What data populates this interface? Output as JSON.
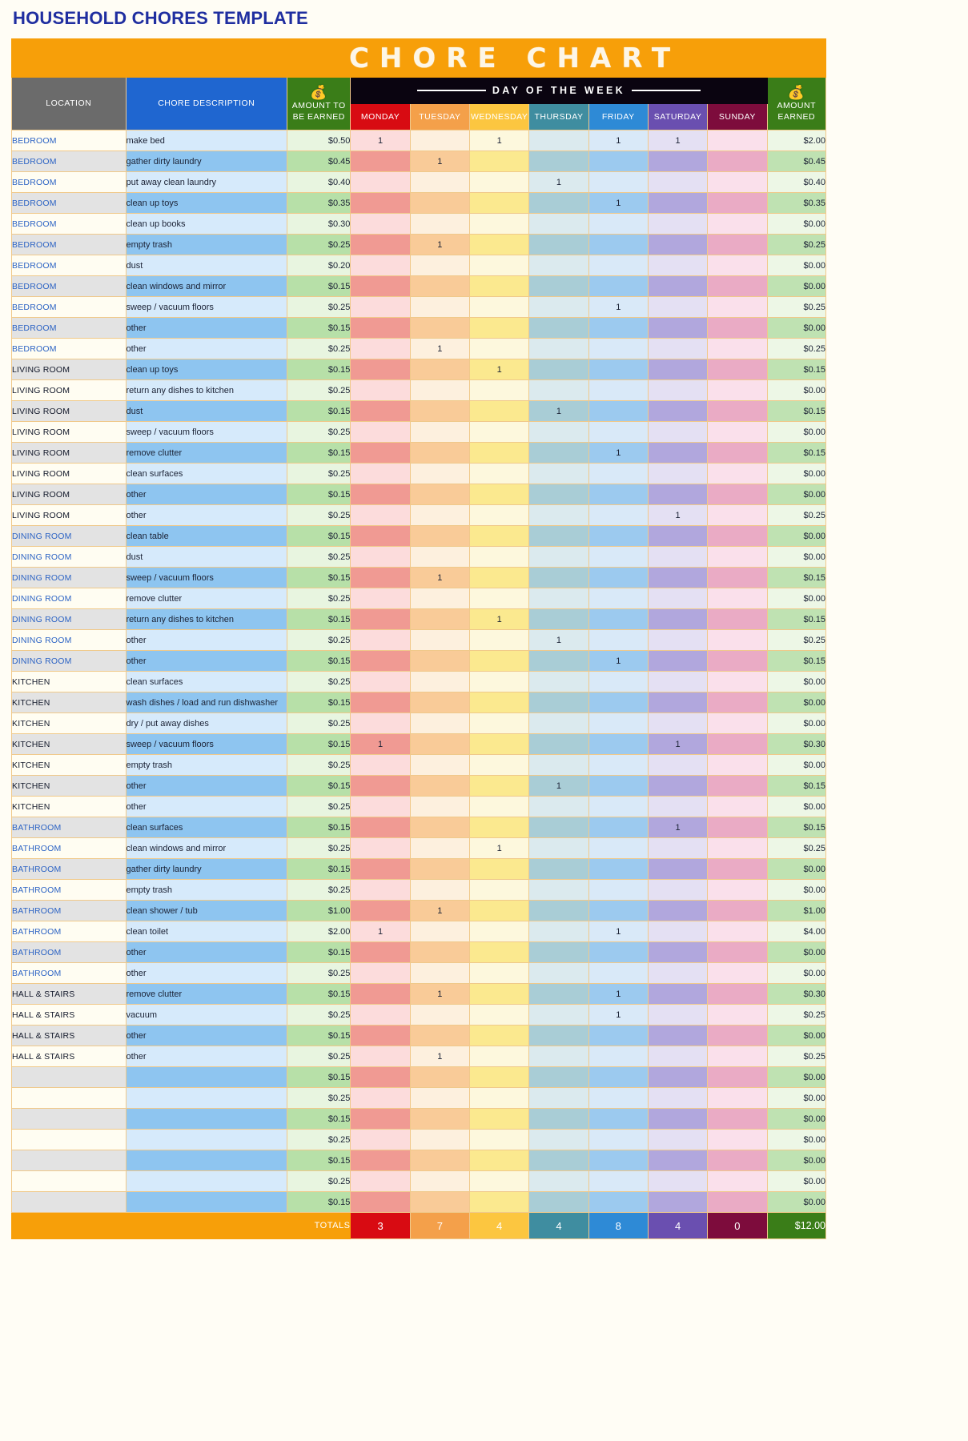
{
  "document": {
    "title": "HOUSEHOLD CHORES TEMPLATE",
    "banner": "CHORE CHART"
  },
  "colors": {
    "title_blue": "#1f2ea0",
    "banner_orange": "#f79f09",
    "location_header_gray": "#6b6b6b",
    "description_header_blue": "#1f66d0",
    "amount_header_green": "#3a7d18",
    "monday_red": "#d80b12",
    "tuesday_orange": "#f4a04a",
    "wednesday_yellow": "#fcc640",
    "thursday_teal": "#3f8da0",
    "friday_blue": "#2e8ad6",
    "saturday_purple": "#6a4fb0",
    "sunday_maroon": "#7d0c3c",
    "day_of_week_bar": "#0a0410"
  },
  "icons": {
    "money_bag": "$"
  },
  "header": {
    "day_of_week_label": "DAY OF THE WEEK",
    "location": "LOCATION",
    "chore_description": "CHORE DESCRIPTION",
    "amount_to_be_earned": "AMOUNT TO BE EARNED",
    "amount_to_be_earned_line1": "AMOUNT TO",
    "amount_to_be_earned_line2": "BE EARNED",
    "amount_earned_line1": "AMOUNT",
    "amount_earned_line2": "EARNED",
    "days": [
      "MONDAY",
      "TUESDAY",
      "WEDNESDAY",
      "THURSDAY",
      "FRIDAY",
      "SATURDAY",
      "SUNDAY"
    ]
  },
  "chart_data": {
    "type": "table",
    "title": "CHORE CHART",
    "columns": [
      "LOCATION",
      "CHORE DESCRIPTION",
      "AMOUNT TO BE EARNED",
      "MONDAY",
      "TUESDAY",
      "WEDNESDAY",
      "THURSDAY",
      "FRIDAY",
      "SATURDAY",
      "SUNDAY",
      "AMOUNT EARNED"
    ],
    "rows": [
      {
        "location": "BEDROOM",
        "chore": "make bed",
        "amount": "$0.50",
        "days": [
          "1",
          "",
          "1",
          "",
          "1",
          "1",
          ""
        ],
        "earned": "$2.00"
      },
      {
        "location": "BEDROOM",
        "chore": "gather dirty laundry",
        "amount": "$0.45",
        "days": [
          "",
          "1",
          "",
          "",
          "",
          "",
          ""
        ],
        "earned": "$0.45"
      },
      {
        "location": "BEDROOM",
        "chore": "put away clean laundry",
        "amount": "$0.40",
        "days": [
          "",
          "",
          "",
          "1",
          "",
          "",
          ""
        ],
        "earned": "$0.40"
      },
      {
        "location": "BEDROOM",
        "chore": "clean up toys",
        "amount": "$0.35",
        "days": [
          "",
          "",
          "",
          "",
          "1",
          "",
          ""
        ],
        "earned": "$0.35"
      },
      {
        "location": "BEDROOM",
        "chore": "clean up books",
        "amount": "$0.30",
        "days": [
          "",
          "",
          "",
          "",
          "",
          "",
          ""
        ],
        "earned": "$0.00"
      },
      {
        "location": "BEDROOM",
        "chore": "empty trash",
        "amount": "$0.25",
        "days": [
          "",
          "1",
          "",
          "",
          "",
          "",
          ""
        ],
        "earned": "$0.25"
      },
      {
        "location": "BEDROOM",
        "chore": "dust",
        "amount": "$0.20",
        "days": [
          "",
          "",
          "",
          "",
          "",
          "",
          ""
        ],
        "earned": "$0.00"
      },
      {
        "location": "BEDROOM",
        "chore": "clean windows and mirror",
        "amount": "$0.15",
        "days": [
          "",
          "",
          "",
          "",
          "",
          "",
          ""
        ],
        "earned": "$0.00"
      },
      {
        "location": "BEDROOM",
        "chore": "sweep / vacuum floors",
        "amount": "$0.25",
        "days": [
          "",
          "",
          "",
          "",
          "1",
          "",
          ""
        ],
        "earned": "$0.25"
      },
      {
        "location": "BEDROOM",
        "chore": "other",
        "amount": "$0.15",
        "days": [
          "",
          "",
          "",
          "",
          "",
          "",
          ""
        ],
        "earned": "$0.00"
      },
      {
        "location": "BEDROOM",
        "chore": "other",
        "amount": "$0.25",
        "days": [
          "",
          "1",
          "",
          "",
          "",
          "",
          ""
        ],
        "earned": "$0.25"
      },
      {
        "location": "LIVING ROOM",
        "chore": "clean up toys",
        "amount": "$0.15",
        "days": [
          "",
          "",
          "1",
          "",
          "",
          "",
          ""
        ],
        "earned": "$0.15"
      },
      {
        "location": "LIVING ROOM",
        "chore": "return any dishes to kitchen",
        "amount": "$0.25",
        "days": [
          "",
          "",
          "",
          "",
          "",
          "",
          ""
        ],
        "earned": "$0.00"
      },
      {
        "location": "LIVING ROOM",
        "chore": "dust",
        "amount": "$0.15",
        "days": [
          "",
          "",
          "",
          "1",
          "",
          "",
          ""
        ],
        "earned": "$0.15"
      },
      {
        "location": "LIVING ROOM",
        "chore": "sweep / vacuum floors",
        "amount": "$0.25",
        "days": [
          "",
          "",
          "",
          "",
          "",
          "",
          ""
        ],
        "earned": "$0.00"
      },
      {
        "location": "LIVING ROOM",
        "chore": "remove clutter",
        "amount": "$0.15",
        "days": [
          "",
          "",
          "",
          "",
          "1",
          "",
          ""
        ],
        "earned": "$0.15"
      },
      {
        "location": "LIVING ROOM",
        "chore": "clean surfaces",
        "amount": "$0.25",
        "days": [
          "",
          "",
          "",
          "",
          "",
          "",
          ""
        ],
        "earned": "$0.00"
      },
      {
        "location": "LIVING ROOM",
        "chore": "other",
        "amount": "$0.15",
        "days": [
          "",
          "",
          "",
          "",
          "",
          "",
          ""
        ],
        "earned": "$0.00"
      },
      {
        "location": "LIVING ROOM",
        "chore": "other",
        "amount": "$0.25",
        "days": [
          "",
          "",
          "",
          "",
          "",
          "1",
          ""
        ],
        "earned": "$0.25"
      },
      {
        "location": "DINING ROOM",
        "chore": "clean table",
        "amount": "$0.15",
        "days": [
          "",
          "",
          "",
          "",
          "",
          "",
          ""
        ],
        "earned": "$0.00"
      },
      {
        "location": "DINING ROOM",
        "chore": "dust",
        "amount": "$0.25",
        "days": [
          "",
          "",
          "",
          "",
          "",
          "",
          ""
        ],
        "earned": "$0.00"
      },
      {
        "location": "DINING ROOM",
        "chore": "sweep / vacuum floors",
        "amount": "$0.15",
        "days": [
          "",
          "1",
          "",
          "",
          "",
          "",
          ""
        ],
        "earned": "$0.15"
      },
      {
        "location": "DINING ROOM",
        "chore": "remove clutter",
        "amount": "$0.25",
        "days": [
          "",
          "",
          "",
          "",
          "",
          "",
          ""
        ],
        "earned": "$0.00"
      },
      {
        "location": "DINING ROOM",
        "chore": "return any dishes to kitchen",
        "amount": "$0.15",
        "days": [
          "",
          "",
          "1",
          "",
          "",
          "",
          ""
        ],
        "earned": "$0.15"
      },
      {
        "location": "DINING ROOM",
        "chore": "other",
        "amount": "$0.25",
        "days": [
          "",
          "",
          "",
          "1",
          "",
          "",
          ""
        ],
        "earned": "$0.25"
      },
      {
        "location": "DINING ROOM",
        "chore": "other",
        "amount": "$0.15",
        "days": [
          "",
          "",
          "",
          "",
          "1",
          "",
          ""
        ],
        "earned": "$0.15"
      },
      {
        "location": "KITCHEN",
        "chore": "clean surfaces",
        "amount": "$0.25",
        "days": [
          "",
          "",
          "",
          "",
          "",
          "",
          ""
        ],
        "earned": "$0.00"
      },
      {
        "location": "KITCHEN",
        "chore": "wash dishes / load and run dishwasher",
        "amount": "$0.15",
        "days": [
          "",
          "",
          "",
          "",
          "",
          "",
          ""
        ],
        "earned": "$0.00"
      },
      {
        "location": "KITCHEN",
        "chore": "dry / put away dishes",
        "amount": "$0.25",
        "days": [
          "",
          "",
          "",
          "",
          "",
          "",
          ""
        ],
        "earned": "$0.00"
      },
      {
        "location": "KITCHEN",
        "chore": "sweep / vacuum floors",
        "amount": "$0.15",
        "days": [
          "1",
          "",
          "",
          "",
          "",
          "1",
          ""
        ],
        "earned": "$0.30"
      },
      {
        "location": "KITCHEN",
        "chore": "empty trash",
        "amount": "$0.25",
        "days": [
          "",
          "",
          "",
          "",
          "",
          "",
          ""
        ],
        "earned": "$0.00"
      },
      {
        "location": "KITCHEN",
        "chore": "other",
        "amount": "$0.15",
        "days": [
          "",
          "",
          "",
          "1",
          "",
          "",
          ""
        ],
        "earned": "$0.15"
      },
      {
        "location": "KITCHEN",
        "chore": "other",
        "amount": "$0.25",
        "days": [
          "",
          "",
          "",
          "",
          "",
          "",
          ""
        ],
        "earned": "$0.00"
      },
      {
        "location": "BATHROOM",
        "chore": "clean surfaces",
        "amount": "$0.15",
        "days": [
          "",
          "",
          "",
          "",
          "",
          "1",
          ""
        ],
        "earned": "$0.15"
      },
      {
        "location": "BATHROOM",
        "chore": "clean windows and mirror",
        "amount": "$0.25",
        "days": [
          "",
          "",
          "1",
          "",
          "",
          "",
          ""
        ],
        "earned": "$0.25"
      },
      {
        "location": "BATHROOM",
        "chore": "gather dirty laundry",
        "amount": "$0.15",
        "days": [
          "",
          "",
          "",
          "",
          "",
          "",
          ""
        ],
        "earned": "$0.00"
      },
      {
        "location": "BATHROOM",
        "chore": "empty trash",
        "amount": "$0.25",
        "days": [
          "",
          "",
          "",
          "",
          "",
          "",
          ""
        ],
        "earned": "$0.00"
      },
      {
        "location": "BATHROOM",
        "chore": "clean shower / tub",
        "amount": "$1.00",
        "days": [
          "",
          "1",
          "",
          "",
          "",
          "",
          ""
        ],
        "earned": "$1.00"
      },
      {
        "location": "BATHROOM",
        "chore": "clean toilet",
        "amount": "$2.00",
        "days": [
          "1",
          "",
          "",
          "",
          "1",
          "",
          ""
        ],
        "earned": "$4.00"
      },
      {
        "location": "BATHROOM",
        "chore": "other",
        "amount": "$0.15",
        "days": [
          "",
          "",
          "",
          "",
          "",
          "",
          ""
        ],
        "earned": "$0.00"
      },
      {
        "location": "BATHROOM",
        "chore": "other",
        "amount": "$0.25",
        "days": [
          "",
          "",
          "",
          "",
          "",
          "",
          ""
        ],
        "earned": "$0.00"
      },
      {
        "location": "HALL & STAIRS",
        "chore": "remove clutter",
        "amount": "$0.15",
        "days": [
          "",
          "1",
          "",
          "",
          "1",
          "",
          ""
        ],
        "earned": "$0.30"
      },
      {
        "location": "HALL & STAIRS",
        "chore": "vacuum",
        "amount": "$0.25",
        "days": [
          "",
          "",
          "",
          "",
          "1",
          "",
          ""
        ],
        "earned": "$0.25"
      },
      {
        "location": "HALL & STAIRS",
        "chore": "other",
        "amount": "$0.15",
        "days": [
          "",
          "",
          "",
          "",
          "",
          "",
          ""
        ],
        "earned": "$0.00"
      },
      {
        "location": "HALL & STAIRS",
        "chore": "other",
        "amount": "$0.25",
        "days": [
          "",
          "1",
          "",
          "",
          "",
          "",
          ""
        ],
        "earned": "$0.25"
      },
      {
        "location": "",
        "chore": "",
        "amount": "$0.15",
        "days": [
          "",
          "",
          "",
          "",
          "",
          "",
          ""
        ],
        "earned": "$0.00"
      },
      {
        "location": "",
        "chore": "",
        "amount": "$0.25",
        "days": [
          "",
          "",
          "",
          "",
          "",
          "",
          ""
        ],
        "earned": "$0.00"
      },
      {
        "location": "",
        "chore": "",
        "amount": "$0.15",
        "days": [
          "",
          "",
          "",
          "",
          "",
          "",
          ""
        ],
        "earned": "$0.00"
      },
      {
        "location": "",
        "chore": "",
        "amount": "$0.25",
        "days": [
          "",
          "",
          "",
          "",
          "",
          "",
          ""
        ],
        "earned": "$0.00"
      },
      {
        "location": "",
        "chore": "",
        "amount": "$0.15",
        "days": [
          "",
          "",
          "",
          "",
          "",
          "",
          ""
        ],
        "earned": "$0.00"
      },
      {
        "location": "",
        "chore": "",
        "amount": "$0.25",
        "days": [
          "",
          "",
          "",
          "",
          "",
          "",
          ""
        ],
        "earned": "$0.00"
      },
      {
        "location": "",
        "chore": "",
        "amount": "$0.15",
        "days": [
          "",
          "",
          "",
          "",
          "",
          "",
          ""
        ],
        "earned": "$0.00"
      }
    ],
    "totals": {
      "label": "TOTALS",
      "days": [
        "3",
        "7",
        "4",
        "4",
        "8",
        "4",
        "0"
      ],
      "earned": "$12.00"
    }
  }
}
